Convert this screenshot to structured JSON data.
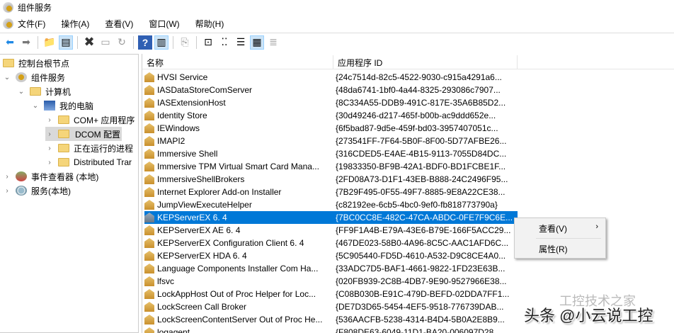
{
  "window": {
    "title": "组件服务"
  },
  "menu": [
    "文件(F)",
    "操作(A)",
    "查看(V)",
    "窗口(W)",
    "帮助(H)"
  ],
  "tree": [
    {
      "label": "控制台根节点",
      "level": 0,
      "chev": ""
    },
    {
      "label": "组件服务",
      "level": 1,
      "chev": "⌄"
    },
    {
      "label": "计算机",
      "level": 2,
      "chev": "⌄"
    },
    {
      "label": "我的电脑",
      "level": 3,
      "chev": "⌄"
    },
    {
      "label": "COM+ 应用程序",
      "level": 4,
      "chev": "›"
    },
    {
      "label": "DCOM 配置",
      "level": 4,
      "chev": "›"
    },
    {
      "label": "正在运行的进程",
      "level": 4,
      "chev": "›"
    },
    {
      "label": "Distributed Trar",
      "level": 4,
      "chev": "›"
    },
    {
      "label": "事件查看器 (本地)",
      "level": 1,
      "chev": "›"
    },
    {
      "label": "服务(本地)",
      "level": 1,
      "chev": "›"
    }
  ],
  "list": {
    "columns": [
      "名称",
      "应用程序 ID"
    ],
    "rows": [
      [
        "HVSI Service",
        "{24c7514d-82c5-4522-9030-c915a4291a6..."
      ],
      [
        "IASDataStoreComServer",
        "{48da6741-1bf0-4a44-8325-293086c7907..."
      ],
      [
        "IASExtensionHost",
        "{8C334A55-DDB9-491C-817E-35A6B85D2..."
      ],
      [
        "Identity Store",
        "{30d49246-d217-465f-b00b-ac9ddd652e..."
      ],
      [
        "IEWindows",
        "{6f5bad87-9d5e-459f-bd03-3957407051c..."
      ],
      [
        "IMAPI2",
        "{273541FF-7F64-5B0F-8F00-5D77AFBE26..."
      ],
      [
        "Immersive Shell",
        "{316CDED5-E4AE-4B15-9113-7055D84DC..."
      ],
      [
        "Immersive TPM Virtual Smart Card Mana...",
        "{19833350-BF9B-42A1-BDF0-BD1FCBE1F..."
      ],
      [
        "ImmersiveShellBrokers",
        "{2FD08A73-D1F1-43EB-B888-24C2496F95..."
      ],
      [
        "Internet Explorer Add-on Installer",
        "{7B29F495-0F55-49F7-8885-9E8A22CE38..."
      ],
      [
        "JumpViewExecuteHelper",
        "{c82192ee-6cb5-4bc0-9ef0-fb818773790a}"
      ],
      [
        "KEPServerEX 6. 4",
        "{7BC0CC8E-482C-47CA-ABDC-0FE7F9C6E..."
      ],
      [
        "KEPServerEX AE 6. 4",
        "{FF9F1A4B-E79A-43E6-B79E-166F5ACC29..."
      ],
      [
        "KEPServerEX Configuration Client 6. 4",
        "{467DE023-58B0-4A96-8C5C-AAC1AFD6C..."
      ],
      [
        "KEPServerEX HDA 6. 4",
        "{5C905440-FD5D-4610-A532-D9C8CE4A0..."
      ],
      [
        "Language Components Installer Com Ha...",
        "{33ADC7D5-BAF1-4661-9822-1FD23E63B..."
      ],
      [
        "lfsvc",
        "{020FB939-2C8B-4DB7-9E90-9527966E38..."
      ],
      [
        "LockAppHost Out of Proc Helper for Loc...",
        "{C08B030B-E91C-479D-BEFD-02DDA7FF1..."
      ],
      [
        "LockScreen Call Broker",
        "{DE7D3D65-5454-4EF5-9518-776739DAB..."
      ],
      [
        "LockScreenContentServer Out of Proc He...",
        "{536AACFB-5238-4314-B4D4-5B0A2E8B9..."
      ],
      [
        "logagent",
        "{F808DE63-6049-11D1-BA20-006097D28..."
      ]
    ],
    "selected_index": 11
  },
  "context_menu": [
    "查看(V)",
    "属性(R)"
  ],
  "watermark": {
    "line1": "工控技术之家",
    "line2": "头条 @小云说工控"
  }
}
